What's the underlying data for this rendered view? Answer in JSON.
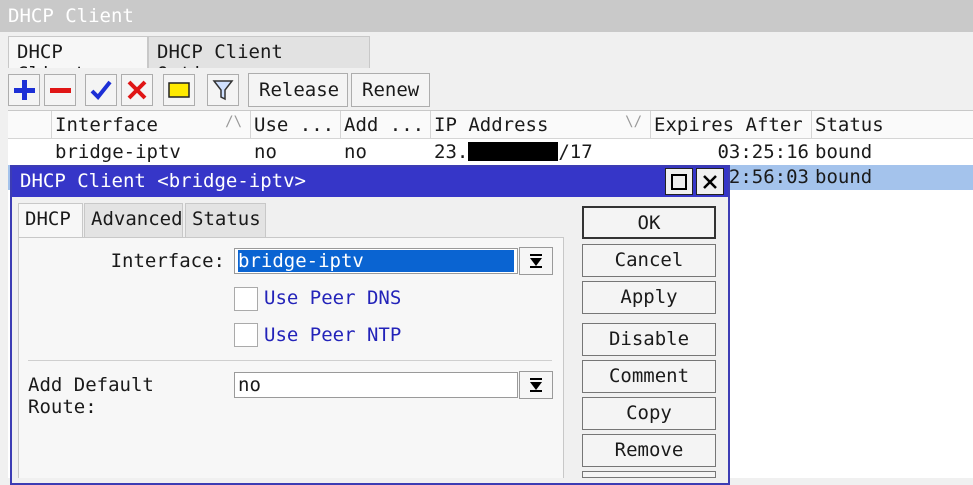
{
  "window": {
    "title": "DHCP Client"
  },
  "tabs": [
    "DHCP Client",
    "DHCP Client Options"
  ],
  "toolbar": {
    "release_label": "Release",
    "renew_label": "Renew"
  },
  "table": {
    "columns": [
      "Interface",
      "Use ...",
      "Add ...",
      "IP Address",
      "Expires After",
      "Status"
    ],
    "rows": [
      {
        "interface": "bridge-iptv",
        "use_peer": "no",
        "add_route": "no",
        "ip_prefix": "23.",
        "ip_suffix": "/17",
        "expires": "03:25:16",
        "status": "bound"
      },
      {
        "expires_partial": "2:56:03",
        "status": "bound"
      }
    ]
  },
  "dialog": {
    "title": "DHCP Client <bridge-iptv>",
    "tabs": [
      "DHCP",
      "Advanced",
      "Status"
    ],
    "interface_label": "Interface:",
    "interface_value": "bridge-iptv",
    "use_peer_dns_label": "Use Peer DNS",
    "use_peer_ntp_label": "Use Peer NTP",
    "default_route_label": "Add Default Route:",
    "default_route_value": "no",
    "buttons": [
      "OK",
      "Cancel",
      "Apply",
      "Disable",
      "Comment",
      "Copy",
      "Remove"
    ]
  },
  "colors": {
    "dialog_title_bg": "#3636c8",
    "selected_row": "#a4c3ec",
    "selected_input": "#0a64d2"
  }
}
